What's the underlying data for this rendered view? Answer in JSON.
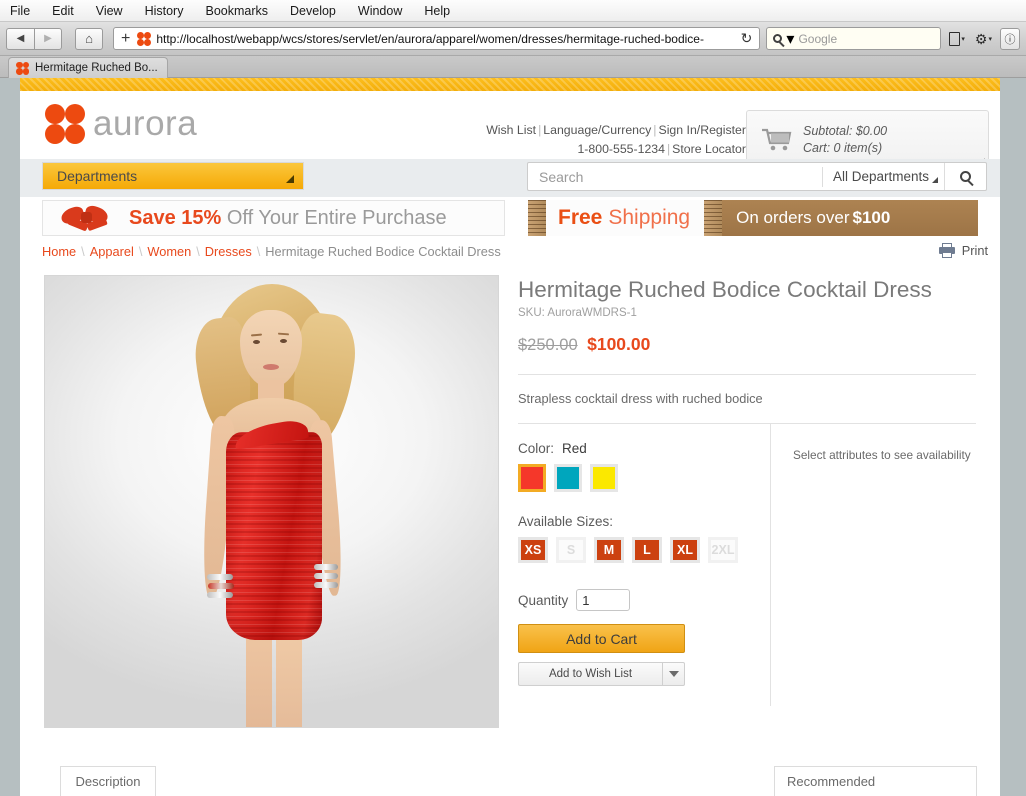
{
  "os_menu": {
    "items": [
      "File",
      "Edit",
      "View",
      "History",
      "Bookmarks",
      "Develop",
      "Window",
      "Help"
    ]
  },
  "browser": {
    "back_glyph": "◀",
    "forward_glyph": "▶",
    "home_glyph": "⌂",
    "new_tab_glyph": "+",
    "url": "http://localhost/webapp/wcs/stores/servlet/en/aurora/apparel/women/dresses/hermitage-ruched-bodice-",
    "reload_glyph": "↻",
    "search_placeholder": "Google",
    "search_value": "",
    "search_glyph": "⌕",
    "page_icon_glyph": "὜B",
    "gear_glyph": "⚙",
    "info_glyph": "ⓘ",
    "caret_glyph": "▾",
    "tab_title": "Hermitage Ruched Bo..."
  },
  "site": {
    "logo_text": "aurora",
    "header_links_row1": [
      "Wish List",
      "Language/Currency",
      "Sign In/Register"
    ],
    "header_links_row2": [
      "1-800-555-1234",
      "Store Locator"
    ],
    "cart": {
      "subtotal_line": "Subtotal: $0.00",
      "items_line": "Cart: 0 item(s)"
    },
    "departments_label": "Departments",
    "search": {
      "placeholder": "Search",
      "value": "",
      "scope_label": "All Departments"
    }
  },
  "promos": {
    "left": {
      "highlight": "Save 15%",
      "rest": " Off Your Entire Purchase"
    },
    "right": {
      "free": "Free",
      "shipping": "Shipping",
      "condition_prefix": "On orders over ",
      "condition_amount": "$100"
    }
  },
  "breadcrumb": {
    "links": [
      "Home",
      "Apparel",
      "Women",
      "Dresses"
    ],
    "current": "Hermitage Ruched Bodice Cocktail Dress",
    "separator": "\\"
  },
  "print": {
    "label": "Print"
  },
  "product": {
    "title": "Hermitage Ruched Bodice Cocktail Dress",
    "sku": "SKU: AuroraWMDRS-1",
    "price_old": "$250.00",
    "price_new": "$100.00",
    "description": "Strapless cocktail dress with ruched bodice",
    "color_label": "Color:",
    "color_value": "Red",
    "colors": [
      {
        "name": "Red",
        "hex": "#f5372a",
        "selected": true
      },
      {
        "name": "Teal",
        "hex": "#00a6bd",
        "selected": false
      },
      {
        "name": "Yellow",
        "hex": "#fbe800",
        "selected": false
      }
    ],
    "sizes_label": "Available Sizes:",
    "sizes": [
      {
        "label": "XS",
        "available": true
      },
      {
        "label": "S",
        "available": false
      },
      {
        "label": "M",
        "available": true
      },
      {
        "label": "L",
        "available": true
      },
      {
        "label": "XL",
        "available": true
      },
      {
        "label": "2XL",
        "available": false
      }
    ],
    "quantity_label": "Quantity",
    "quantity_value": "1",
    "add_to_cart_label": "Add to Cart",
    "add_to_wish_list_label": "Add to Wish List",
    "availability_message": "Select attributes to see availability"
  },
  "bottom_tabs": {
    "description": "Description",
    "recommended": "Recommended"
  },
  "colors": {
    "accent_orange": "#e8491d",
    "gold": "#f0a415",
    "size_chip": "#cc4110"
  }
}
